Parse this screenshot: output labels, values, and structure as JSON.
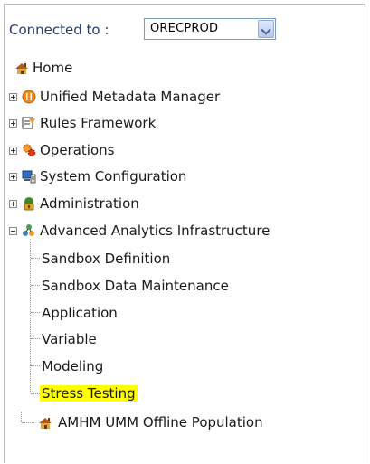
{
  "connection": {
    "label": "Connected to :",
    "selected": "ORECPROD"
  },
  "tree": {
    "home": "Home",
    "items": [
      {
        "label": "Unified Metadata Manager",
        "icon": "umm-icon"
      },
      {
        "label": "Rules Framework",
        "icon": "rules-icon"
      },
      {
        "label": "Operations",
        "icon": "operations-icon"
      },
      {
        "label": "System Configuration",
        "icon": "system-config-icon"
      },
      {
        "label": "Administration",
        "icon": "administration-icon"
      },
      {
        "label": "Advanced Analytics Infrastructure",
        "icon": "analytics-icon"
      }
    ],
    "children": [
      "Sandbox Definition",
      "Sandbox Data Maintenance",
      "Application",
      "Variable",
      "Modeling",
      "Stress Testing"
    ],
    "bottom": "AMHM UMM Offline Population"
  },
  "colors": {
    "highlight": "#ffff00",
    "label_blue": "#2a3b6a"
  }
}
